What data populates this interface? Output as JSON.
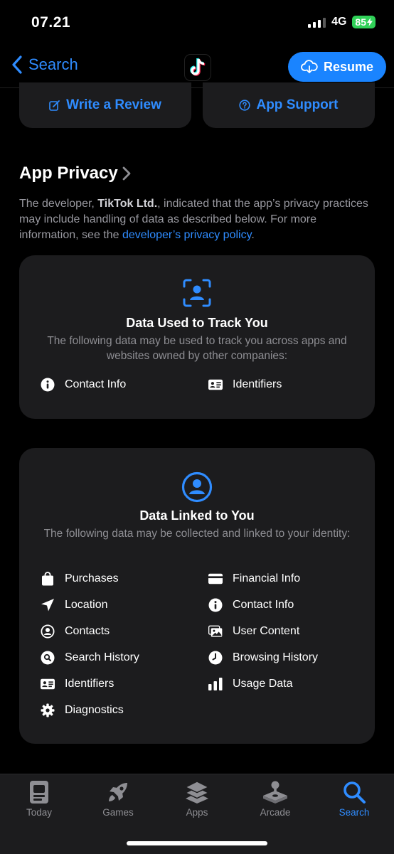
{
  "status": {
    "time": "07.21",
    "network": "4G",
    "battery": "85"
  },
  "nav": {
    "back_label": "Search",
    "resume_label": "Resume"
  },
  "actions": {
    "write_review": "Write a Review",
    "app_support": "App Support"
  },
  "privacy": {
    "title": "App Privacy",
    "desc_prefix": "The developer, ",
    "developer": "TikTok Ltd.",
    "desc_middle": ", indicated that the app’s privacy practices may include handling of data as described below. For more information, see the ",
    "policy_link": "developer’s privacy policy",
    "desc_suffix": "."
  },
  "track_card": {
    "title": "Data Used to Track You",
    "subtitle": "The following data may be used to track you across apps and websites owned by other companies:",
    "items": [
      "Contact Info",
      "Identifiers"
    ]
  },
  "linked_card": {
    "title": "Data Linked to You",
    "subtitle": "The following data may be collected and linked to your identity:",
    "items": [
      "Purchases",
      "Financial Info",
      "Location",
      "Contact Info",
      "Contacts",
      "User Content",
      "Search History",
      "Browsing History",
      "Identifiers",
      "Usage Data",
      "Diagnostics"
    ]
  },
  "tabs": [
    "Today",
    "Games",
    "Apps",
    "Arcade",
    "Search"
  ],
  "colors": {
    "accent": "#2f8cff",
    "card": "#1c1c1e",
    "battery": "#30d158"
  }
}
